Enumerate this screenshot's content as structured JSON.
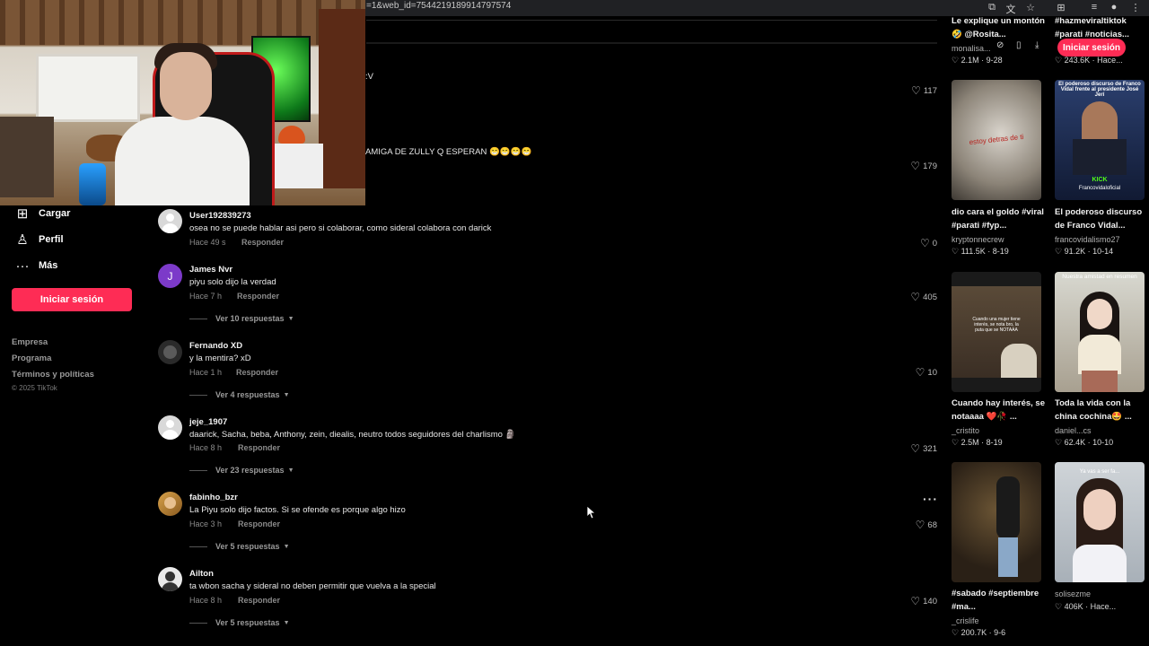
{
  "browser": {
    "url_fragment": "=1&web_id=7544219189914797574"
  },
  "sidebar": {
    "items": [
      {
        "label": "Cargar",
        "icon": "plus-square-icon"
      },
      {
        "label": "Perfil",
        "icon": "person-icon"
      },
      {
        "label": "Más",
        "icon": "more-dots-icon"
      }
    ],
    "login_label": "Iniciar sesión",
    "footer": [
      "Empresa",
      "Programa",
      "Términos y políticas"
    ],
    "copyright": "© 2025 TikTok"
  },
  "partial_comments": [
    {
      "text": ":V",
      "likes": "117"
    },
    {
      "text": "AMIGA DE ZULLY Q ESPERAN 😁😁😁😁",
      "likes": "179"
    }
  ],
  "comments": [
    {
      "user": "User192839273",
      "text": "osea no se puede hablar asi pero si colaborar, como sideral colabora con darick",
      "time": "Hace 49 s",
      "reply": "Responder",
      "likes": "0",
      "more": ""
    },
    {
      "user": "James Nvr",
      "text": "piyu solo dijo la verdad",
      "time": "Hace 7 h",
      "reply": "Responder",
      "likes": "405",
      "more": "Ver 10 respuestas",
      "initial": "J"
    },
    {
      "user": "Fernando XD",
      "text": "y la mentira? xD",
      "time": "Hace 1 h",
      "reply": "Responder",
      "likes": "10",
      "more": "Ver 4 respuestas"
    },
    {
      "user": "jeje_1907",
      "text": "daarick, Sacha, beba, Anthony, zein, diealis, neutro todos seguidores del charlismo 🗿",
      "time": "Hace 8 h",
      "reply": "Responder",
      "likes": "321",
      "more": "Ver 23 respuestas"
    },
    {
      "user": "fabinho_bzr",
      "text": "La Piyu solo dijo factos. Si se ofende es porque algo hizo",
      "time": "Hace 3 h",
      "reply": "Responder",
      "likes": "68",
      "more": "Ver 5 respuestas"
    },
    {
      "user": "Ailton",
      "text": "ta wbon sacha y sideral no deben permitir que vuelva a la special",
      "time": "Hace 8 h",
      "reply": "Responder",
      "likes": "140",
      "more": "Ver 5 respuestas"
    }
  ],
  "videos": {
    "login_label": "Iniciar sesión",
    "top": [
      {
        "title": "Le explique un montón 🤣 @Rosita...",
        "author": "monalisa...",
        "stats": "2.1M · 9-28"
      },
      {
        "title": "#hazmeviraltiktok #parati #noticias...",
        "author": "",
        "stats": "243.6K · Hace..."
      }
    ],
    "grid": [
      {
        "title": "dio cara el goldo #viral #parati #fyp...",
        "author": "kryptonnecrew",
        "stats": "111.5K · 8-19",
        "overlay": "estoy detras de ti"
      },
      {
        "title": "El poderoso discurso de Franco Vidal...",
        "author": "francovidalismo27",
        "stats": "91.2K · 10-14",
        "overlay": "El poderoso discurso de Franco Vidal frente al presidente José Jerí",
        "overlay2": "KICK",
        "overlay3": "Francovidaloficial"
      },
      {
        "title": "Cuando hay interés, se notaaaa ❤️🥀 ...",
        "author": "_cristito",
        "stats": "2.5M · 8-19",
        "overlay": "Cuando una mujer tiene interés, se nota bro, la puta que se NOTAAA"
      },
      {
        "title": "Toda la vida con la china cochina🤩 ...",
        "author": "daniel...cs",
        "stats": "62.4K · 10-10",
        "overlay": "Nuestra amistad en resumen"
      },
      {
        "title": "#sabado #septiembre #ma...",
        "author": "_crislife",
        "stats": "200.7K · 9-6",
        "overlay": ""
      },
      {
        "title": "",
        "author": "solisezme",
        "stats": "406K · Hace...",
        "overlay": "Ya vas a ser fa..."
      }
    ]
  },
  "colors": {
    "accent": "#fe2c55",
    "background": "#000000"
  }
}
